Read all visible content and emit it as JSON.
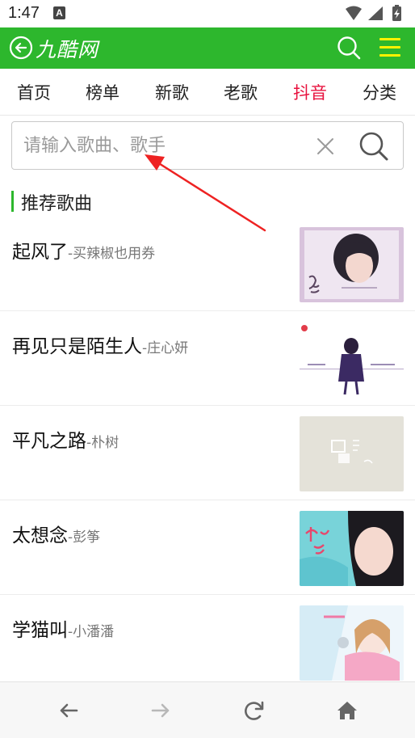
{
  "status_bar": {
    "time": "1:47",
    "notification_badge": "A",
    "icons": [
      "wifi-icon",
      "signal-icon",
      "battery-charging-icon"
    ]
  },
  "header": {
    "logo": "九酷网",
    "back_icon": "back-circle-icon",
    "search_icon": "search-icon",
    "menu_icon": "hamburger-menu-icon",
    "color": "#2db72d",
    "menu_color": "#fff200"
  },
  "nav": {
    "items": [
      {
        "label": "首页",
        "active": false
      },
      {
        "label": "榜单",
        "active": false
      },
      {
        "label": "新歌",
        "active": false
      },
      {
        "label": "老歌",
        "active": false
      },
      {
        "label": "抖音",
        "active": true
      },
      {
        "label": "分类",
        "active": false
      }
    ],
    "active_color": "#e8123e"
  },
  "search": {
    "placeholder": "请输入歌曲、歌手",
    "value": ""
  },
  "section": {
    "title": "推荐歌曲"
  },
  "songs": [
    {
      "title": "起风了",
      "artist": "-买辣椒也用券"
    },
    {
      "title": "再见只是陌生人",
      "artist": "-庄心妍"
    },
    {
      "title": "平凡之路",
      "artist": "-朴树"
    },
    {
      "title": "太想念",
      "artist": "-彭筝"
    },
    {
      "title": "学猫叫",
      "artist": "-小潘潘"
    }
  ],
  "bottom_bar": {
    "icons": [
      "back-arrow-icon",
      "forward-arrow-icon",
      "refresh-icon",
      "home-icon"
    ]
  },
  "annotation": {
    "color": "#ee2222"
  }
}
